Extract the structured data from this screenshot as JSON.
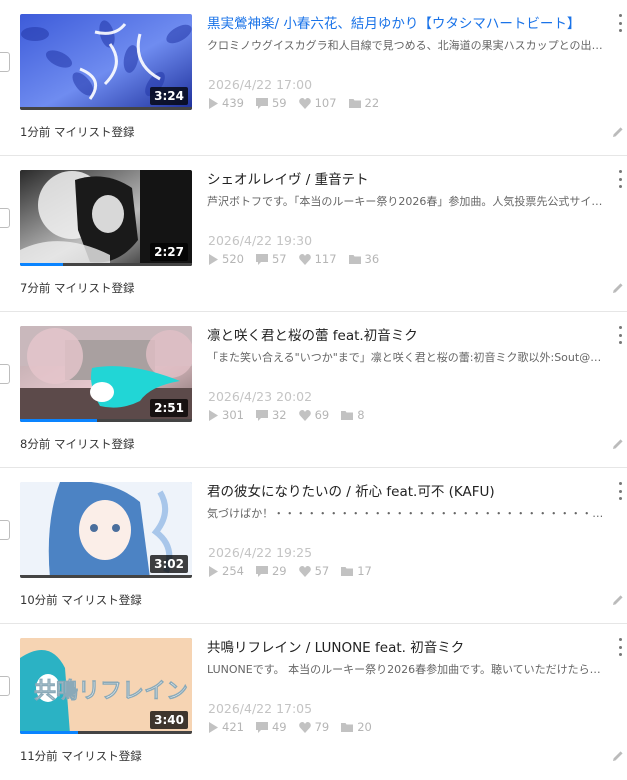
{
  "items": [
    {
      "title": "黒実鶯神楽/ 小春六花、結月ゆかり【ウタシマハートビート】",
      "title_is_link": true,
      "description": "クロミノウグイスカグラ和人目線で見つめる、北海道の果実ハスカップとの出会…",
      "date": "2026/4/22 17:00",
      "views": "439",
      "comments": "59",
      "likes": "107",
      "mylists": "22",
      "duration": "3:24",
      "added": "1分前 マイリスト登録",
      "progress": 0,
      "thumb_colors": [
        "#3d5bd9",
        "#6f8cf0",
        "#1d2f9a"
      ]
    },
    {
      "title": "シェオルレイヴ / 重音テト",
      "title_is_link": false,
      "description": "芦沢ボトフです。「本当のルーキー祭り2026春」参加曲。人気投票先公式サイ…",
      "date": "2026/4/22 19:30",
      "views": "520",
      "comments": "57",
      "likes": "117",
      "mylists": "36",
      "duration": "2:27",
      "added": "7分前 マイリスト登録",
      "progress": 25,
      "thumb_colors": [
        "#2a2a2a",
        "#bdbdbd",
        "#0b0b0b"
      ]
    },
    {
      "title": "凛と咲く君と桜の蕾 feat.初音ミク",
      "title_is_link": false,
      "description": "「また笑い合える\"いつか\"まで」凛と咲く君と桜の蕾:初音ミク歌以外:Sout@…",
      "date": "2026/4/23 20:02",
      "views": "301",
      "comments": "32",
      "likes": "69",
      "mylists": "8",
      "duration": "2:51",
      "added": "8分前 マイリスト登録",
      "progress": 45,
      "thumb_colors": [
        "#b7a6a8",
        "#e8c9cf",
        "#7e6a6a"
      ]
    },
    {
      "title": "君の彼女になりたいの / 祈心 feat.可不 (KAFU)",
      "title_is_link": false,
      "description": "気づけばか！・・・・・・・・・・・・・・・・・・・・・・・・・・・・・・・・・・・・・・・・・・・・・・初投稿です。\"等身大\"ってとて…",
      "date": "2026/4/22 19:25",
      "views": "254",
      "comments": "29",
      "likes": "57",
      "mylists": "17",
      "duration": "3:02",
      "added": "10分前 マイリスト登録",
      "progress": 0,
      "thumb_colors": [
        "#e9eef6",
        "#6aa0d6",
        "#ffffff"
      ]
    },
    {
      "title": "共鳴リフレイン / LUNONE feat. 初音ミク",
      "title_is_link": false,
      "description": "LUNONEです。 本当のルーキー祭り2026春参加曲です。聴いていただけたら嬉…",
      "date": "2026/4/22 17:05",
      "views": "421",
      "comments": "49",
      "likes": "79",
      "mylists": "20",
      "duration": "3:40",
      "added": "11分前 マイリスト登録",
      "progress": 34,
      "thumb_colors": [
        "#f5d2b0",
        "#2fb3c3",
        "#ffffff"
      ],
      "thumb_text": "共鳴リフレイン"
    }
  ]
}
